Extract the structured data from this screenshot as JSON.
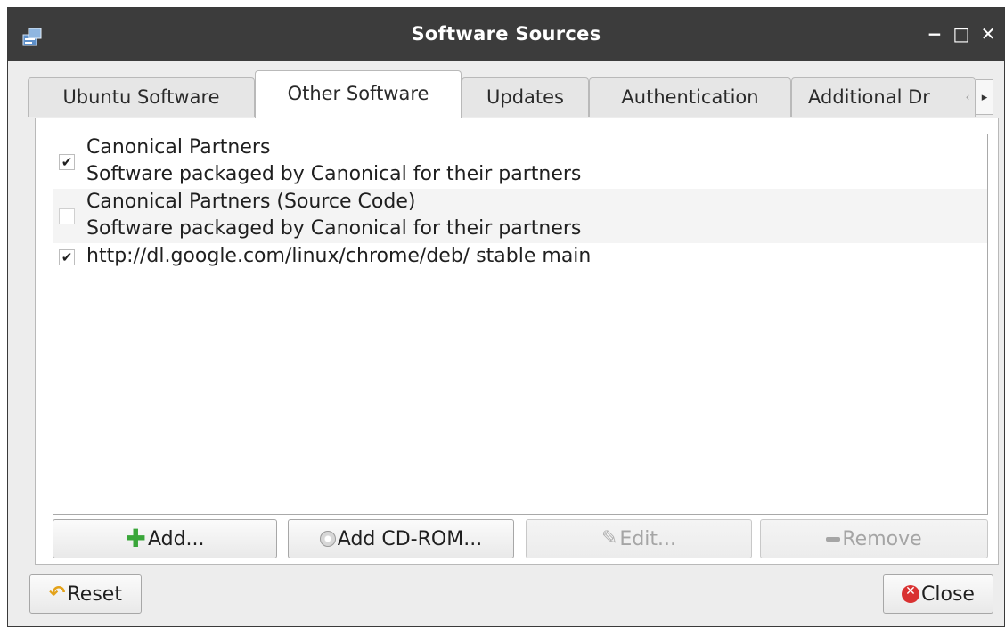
{
  "window": {
    "title": "Software Sources",
    "icon": "software-sources-icon",
    "controls": {
      "minimize": "−",
      "maximize": "□",
      "close": "✕"
    }
  },
  "tabs": [
    {
      "label": "Ubuntu Software",
      "active": false
    },
    {
      "label": "Other Software",
      "active": true
    },
    {
      "label": "Updates",
      "active": false
    },
    {
      "label": "Authentication",
      "active": false
    },
    {
      "label": "Additional Dr",
      "active": false
    }
  ],
  "tab_scroll": {
    "left": "‹",
    "right": "▸"
  },
  "sources": [
    {
      "checked": true,
      "name": "Canonical Partners",
      "description": "Software packaged by Canonical for their partners"
    },
    {
      "checked": false,
      "name": "Canonical Partners (Source Code)",
      "description": "Software packaged by Canonical for their partners"
    },
    {
      "checked": true,
      "name": "http://dl.google.com/linux/chrome/deb/ stable main"
    }
  ],
  "check_mark": "✔",
  "buttons": {
    "add": {
      "label": "Add...",
      "icon": "plus-icon",
      "glyph": "✚",
      "enabled": true
    },
    "add_cdrom": {
      "label": "Add CD-ROM...",
      "icon": "cdrom-icon",
      "enabled": true
    },
    "edit": {
      "label": "Edit...",
      "icon": "pencil-icon",
      "glyph": "✎",
      "enabled": false
    },
    "remove": {
      "label": "Remove",
      "icon": "minus-icon",
      "enabled": false
    },
    "reset": {
      "label": "Reset",
      "icon": "revert-icon",
      "glyph": "↶",
      "enabled": true
    },
    "close": {
      "label": "Close",
      "icon": "close-circle-icon",
      "glyph": "✕",
      "enabled": true
    }
  },
  "colors": {
    "titlebar": "#3c3c3c",
    "add_icon": "#3aa63a",
    "close_icon": "#d93131",
    "reset_icon": "#e3a21a"
  }
}
